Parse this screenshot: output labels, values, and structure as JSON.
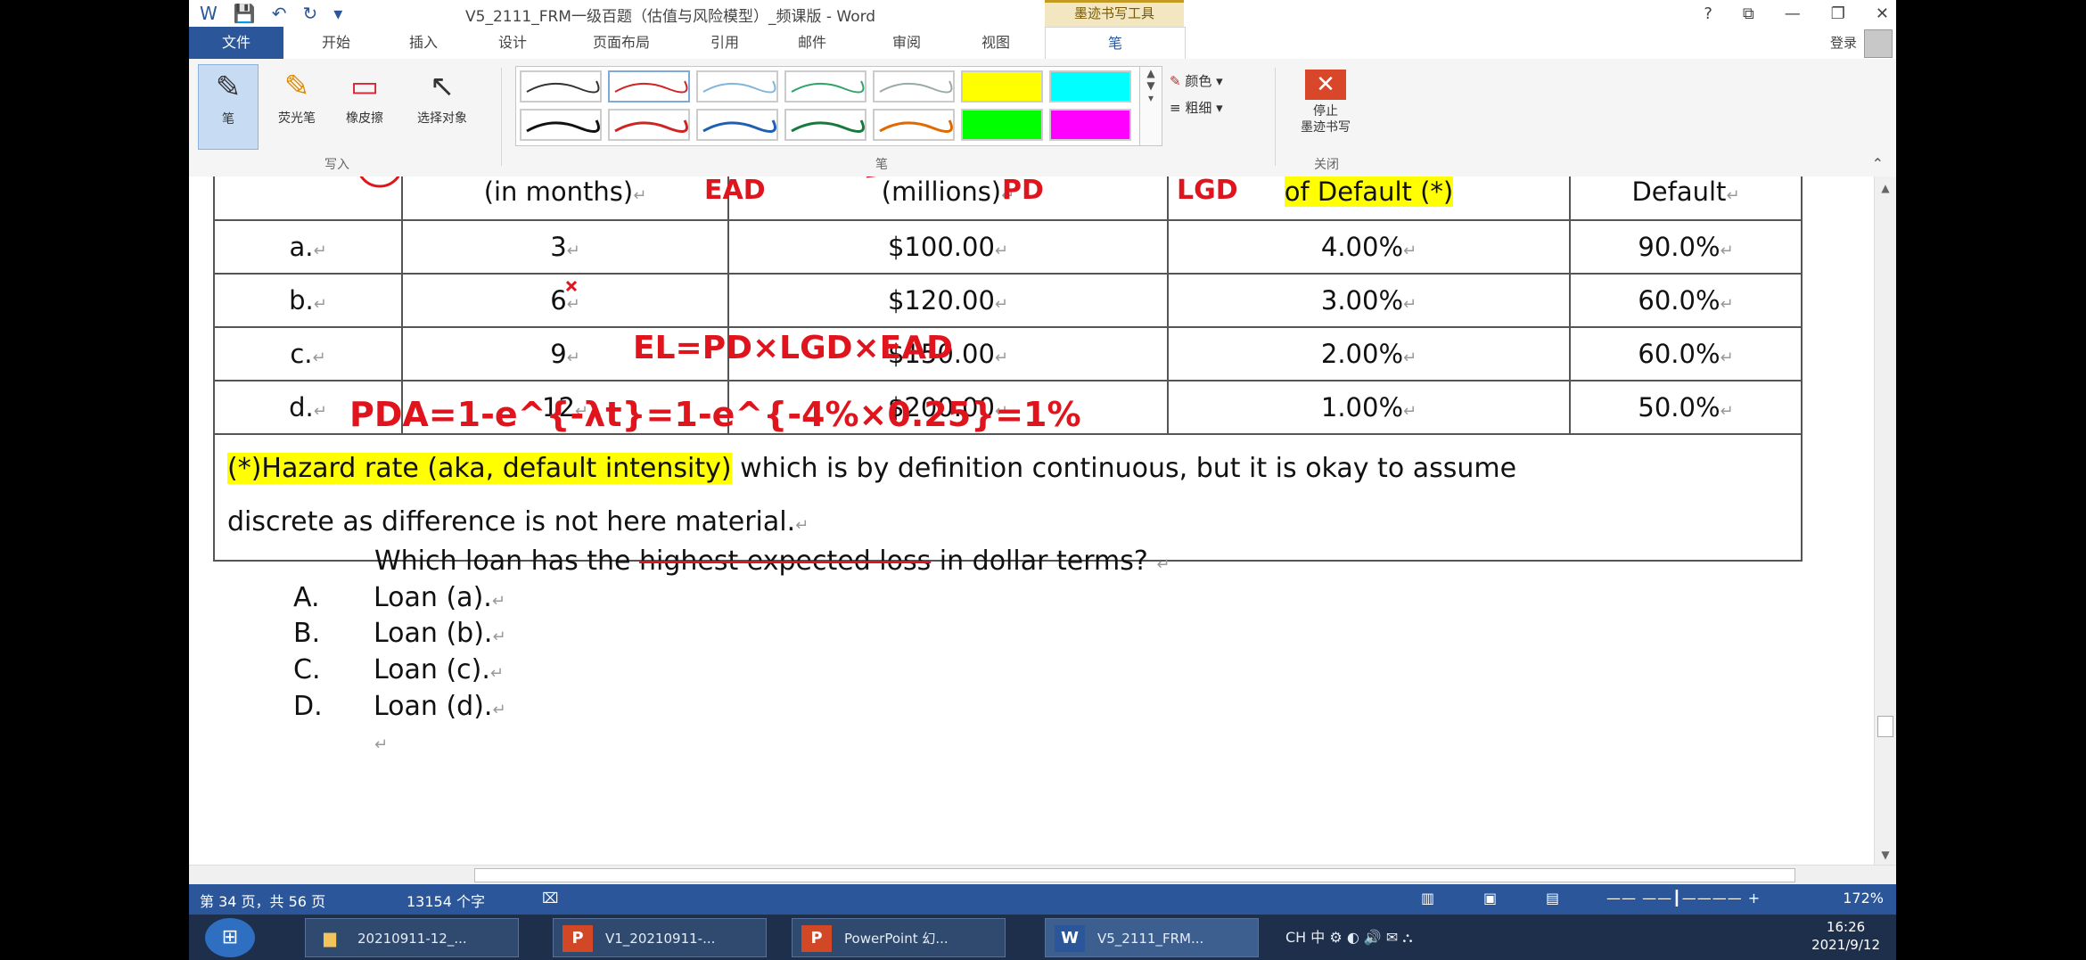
{
  "window": {
    "title": "V5_2111_FRM一级百题（估值与风险模型）_频课版 - Word",
    "context_tab": "墨迹书写工具",
    "controls": [
      "?",
      "⧉",
      "—",
      "❐",
      "✕"
    ]
  },
  "tabs": [
    "文件",
    "开始",
    "插入",
    "设计",
    "页面布局",
    "引用",
    "邮件",
    "审阅",
    "视图",
    "笔"
  ],
  "login": "登录",
  "ribbon": {
    "write_tools": [
      "笔",
      "荧光笔",
      "橡皮擦",
      "选择对象"
    ],
    "group_write": "写入",
    "group_pen": "笔",
    "group_close": "关闭",
    "color_label": "颜色",
    "thickness_label": "粗细",
    "stop_label_1": "停止",
    "stop_label_2": "墨迹书写"
  },
  "table": {
    "header": [
      "",
      "(in months)",
      "(millions)",
      "of Default (*)",
      "Default"
    ],
    "rows": [
      [
        "a.",
        "3",
        "$100.00",
        "4.00%",
        "90.0%"
      ],
      [
        "b.",
        "6",
        "$120.00",
        "3.00%",
        "60.0%"
      ],
      [
        "c.",
        "9",
        "$150.00",
        "2.00%",
        "60.0%"
      ],
      [
        "d.",
        "12",
        "$200.00",
        "1.00%",
        "50.0%"
      ]
    ],
    "note_highlight": "(*)Hazard rate (aka, default intensity)",
    "note_rest": " which is by definition continuous, but it is okay to assume",
    "note_line2": "discrete as difference is not here material."
  },
  "question": {
    "before": "Which loan has the ",
    "struck": "highest expected loss",
    "after": " in dollar terms?",
    "options": [
      {
        "letter": "A.",
        "text": "Loan (a)."
      },
      {
        "letter": "B.",
        "text": "Loan (b)."
      },
      {
        "letter": "C.",
        "text": "Loan (c)."
      },
      {
        "letter": "D.",
        "text": "Loan (d)."
      }
    ]
  },
  "annotations": {
    "ead": "EAD",
    "pd": "PD",
    "lgd": "LGD",
    "el_formula": "EL=PD×LGD×EAD",
    "pd_a_formula": "PDA=1-e^{-λt}=1-e^{-4%×0.25}=1%"
  },
  "status": {
    "page": "第 34 页，共 56 页",
    "words": "13154 个字",
    "zoom": "172%"
  },
  "taskbar": {
    "items": [
      "20210911-12_...",
      "V1_20210911-...",
      "PowerPoint 幻...",
      "V5_2111_FRM..."
    ],
    "time": "16:26",
    "date": "2021/9/12",
    "tray": "CH 中"
  },
  "colors": {
    "accent": "#2b579a",
    "ink": "#e0141c",
    "highlight": "#ffff00"
  }
}
